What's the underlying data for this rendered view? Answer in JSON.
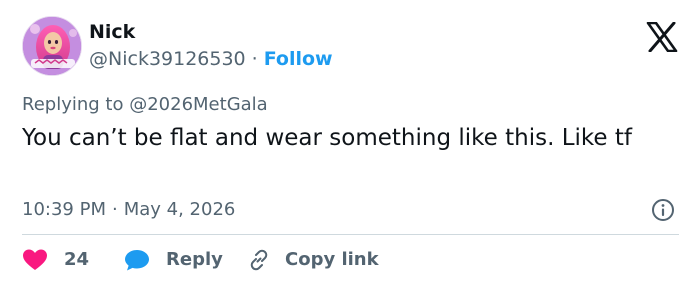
{
  "author": {
    "name": "Nick",
    "handle": "@Nick39126530",
    "separator": "·",
    "follow_label": "Follow",
    "avatar_icon": "avatar-image"
  },
  "platform_icon": "x-logo-icon",
  "replying": {
    "prefix": "Replying to",
    "mention": "@2026MetGala"
  },
  "tweet": {
    "text": "You can’t be flat and wear something like this. Like tf"
  },
  "meta": {
    "time": "10:39 PM",
    "separator": "·",
    "date": "May 4, 2026"
  },
  "actions": {
    "like_count": "24",
    "reply_label": "Reply",
    "copy_link_label": "Copy link"
  },
  "colors": {
    "accent": "#1d9bf0",
    "like": "#f91880",
    "text": "#0f1419",
    "secondary_text": "#536471",
    "divider": "#cfd9de"
  }
}
